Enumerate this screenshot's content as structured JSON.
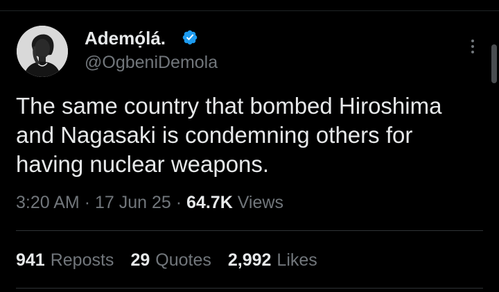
{
  "author": {
    "display_name": "Ademọ́lá.",
    "handle": "@OgbeniDemola",
    "verified_icon": "verified-badge-icon",
    "avatar_icon": "profile-photo"
  },
  "tweet": {
    "text": "The same country that bombed Hiroshima\nand Nagasaki is condemning others for\nhaving nuclear weapons."
  },
  "meta": {
    "time": "3:20 AM",
    "sep1": "·",
    "date": "17 Jun 25",
    "sep2": "·",
    "views_count": "64.7K",
    "views_label": "Views"
  },
  "stats": {
    "reposts_count": "941",
    "reposts_label": "Reposts",
    "quotes_count": "29",
    "quotes_label": "Quotes",
    "likes_count": "2,992",
    "likes_label": "Likes"
  },
  "colors": {
    "background": "#000000",
    "primary_text": "#e7e9ea",
    "secondary_text": "#71767b",
    "verified_blue": "#1d9bf0",
    "divider": "#2f3336"
  },
  "icons": {
    "more": "more-options-icon"
  }
}
